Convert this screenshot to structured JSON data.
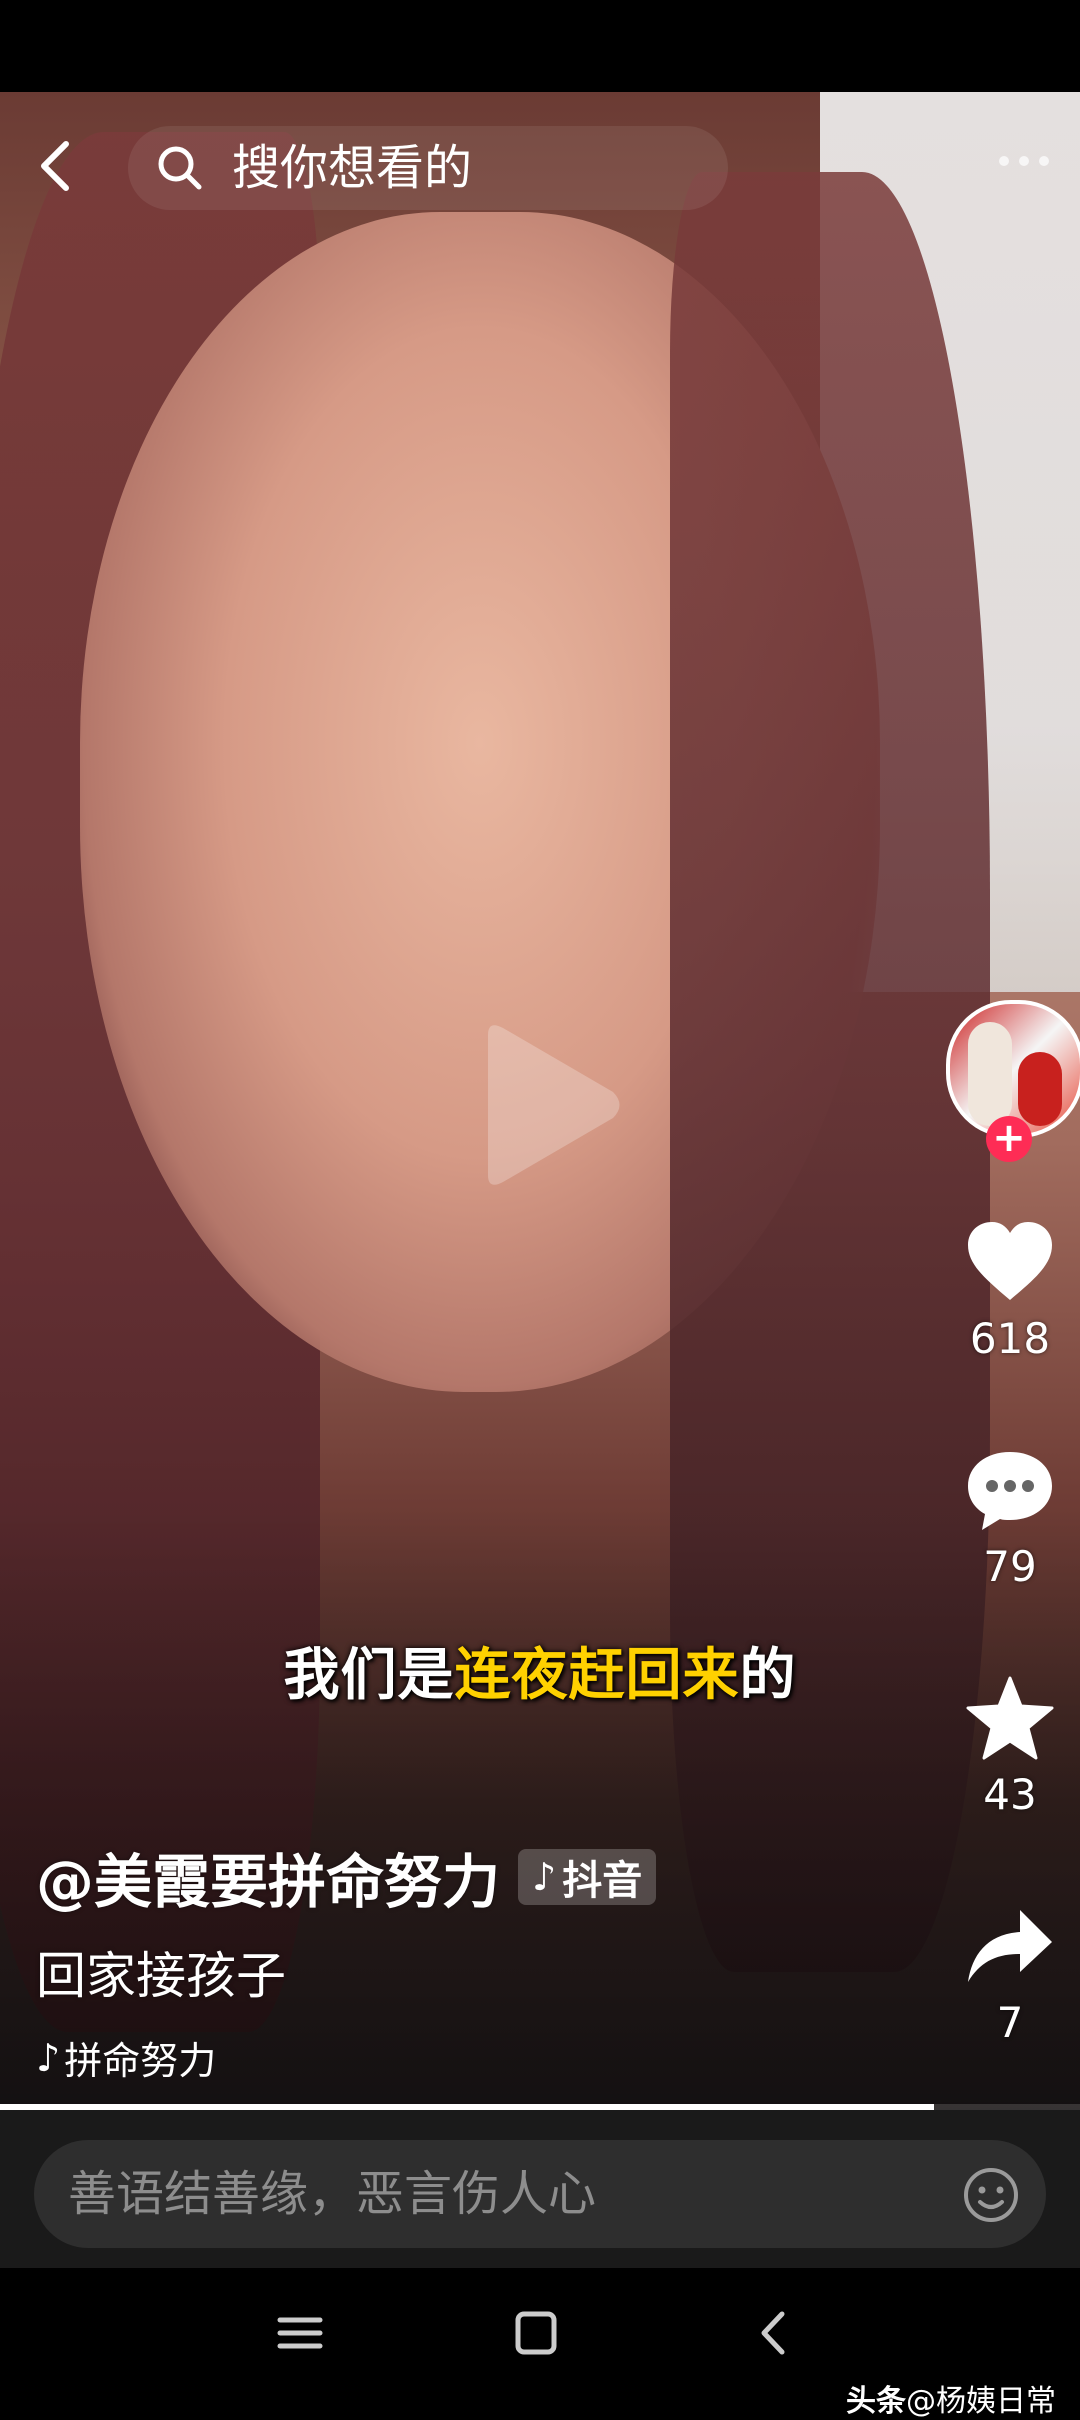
{
  "search": {
    "placeholder": "搜你想看的"
  },
  "caption": {
    "normal_1": "我们是",
    "highlight": "连夜赶回来",
    "normal_2": "的"
  },
  "rail": {
    "likes": "618",
    "comments": "79",
    "favorites": "43",
    "shares": "7",
    "follow_symbol": "+"
  },
  "post": {
    "author": "@美霞要拼命努力",
    "platform": "抖音",
    "platform_note": "♪",
    "description": "回家接孩子",
    "music_note": "♪",
    "music": "拼命努力"
  },
  "progress": {
    "fraction": 0.865
  },
  "comment": {
    "placeholder": "善语结善缘，恶言伤人心"
  },
  "watermark": {
    "brand": "头条",
    "handle": "@杨姨日常"
  },
  "colors": {
    "accent": "#fe2c55",
    "caption_highlight": "#ffd100"
  },
  "icons": [
    "back-icon",
    "search-icon",
    "more-icon",
    "play-icon",
    "heart-icon",
    "comment-icon",
    "star-icon",
    "share-icon",
    "emoji-icon",
    "menu-icon",
    "home-icon",
    "back-nav-icon"
  ]
}
